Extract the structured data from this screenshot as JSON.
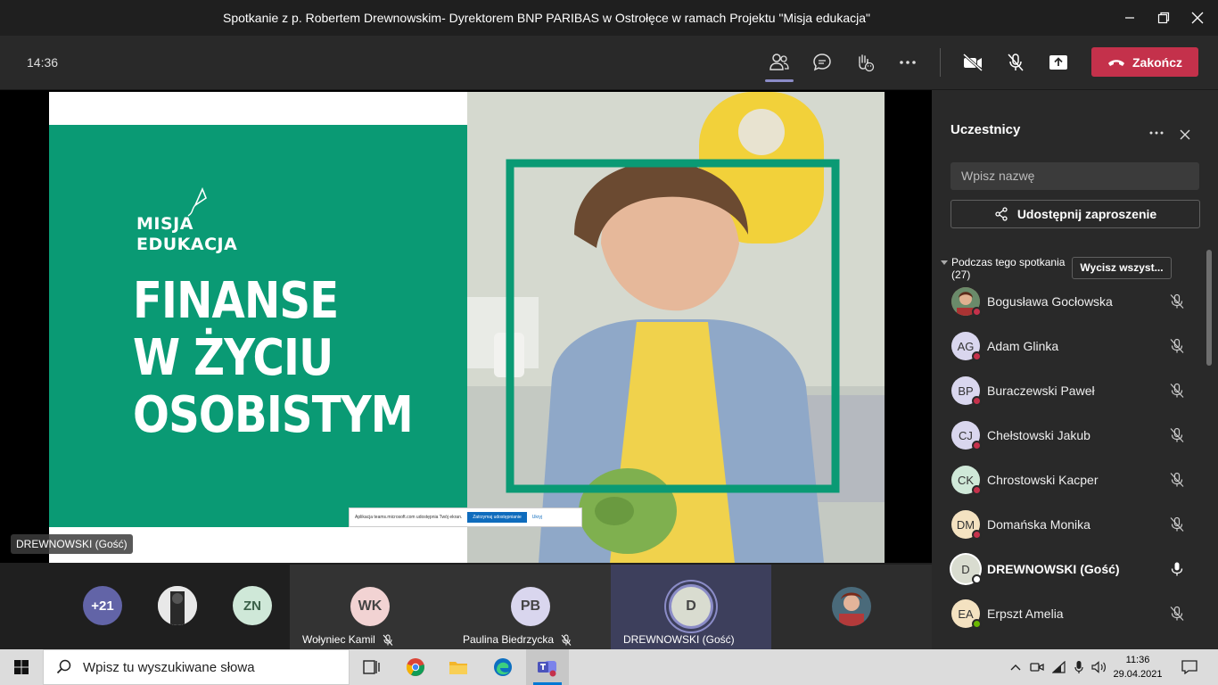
{
  "window": {
    "title": "Spotkanie z p. Robertem Drewnowskim- Dyrektorem BNP PARIBAS w Ostrołęce w ramach Projektu \"Misja edukacja\""
  },
  "toolbar": {
    "timer": "14:36",
    "end_label": "Zakończ"
  },
  "slide": {
    "logo_line1": "MISJA",
    "logo_line2": "EDUKACJA",
    "headline_line1": "FINANSE",
    "headline_line2": "W ŻYCIU",
    "headline_line3": "OSOBISTYM",
    "share_notice": "Aplikacja teams.microsoft.com udostępnia Twój ekran.",
    "share_stop": "Zatrzymaj udostępnianie",
    "share_hide": "Ukryj",
    "presenter_caption": "DREWNOWSKI (Gość)"
  },
  "panel": {
    "title": "Uczestnicy",
    "search_placeholder": "Wpisz nazwę",
    "share_invite": "Udostępnij zaproszenie",
    "section_label": "Podczas tego spotkania (27)",
    "mute_all": "Wycisz wszyst...",
    "participants": [
      {
        "initials": "",
        "name": "Bogusława Gocłowska",
        "photo": true,
        "avatar_color": "#b35a4a",
        "status": "busy",
        "muted": true,
        "bold": false
      },
      {
        "initials": "AG",
        "name": "Adam Glinka",
        "avatar_color": "#d9d6ee",
        "status": "busy",
        "muted": true,
        "bold": false
      },
      {
        "initials": "BP",
        "name": "Buraczewski Paweł",
        "avatar_color": "#d9d6ee",
        "status": "busy",
        "muted": true,
        "bold": false
      },
      {
        "initials": "CJ",
        "name": "Chełstowski Jakub",
        "avatar_color": "#d9d6ee",
        "status": "busy",
        "muted": true,
        "bold": false
      },
      {
        "initials": "CK",
        "name": "Chrostowski Kacper",
        "avatar_color": "#cfe8d8",
        "status": "busy",
        "muted": true,
        "bold": false
      },
      {
        "initials": "DM",
        "name": "Domańska Monika",
        "avatar_color": "#f4e2c1",
        "status": "busy",
        "muted": true,
        "bold": false
      },
      {
        "initials": "D",
        "name": "DREWNOWSKI (Gość)",
        "avatar_color": "#d9dcd0",
        "status": "none",
        "muted": false,
        "bold": true
      },
      {
        "initials": "EA",
        "name": "Erpszt Amelia",
        "avatar_color": "#f4e2c1",
        "status": "available",
        "muted": true,
        "bold": false
      }
    ]
  },
  "gallery": {
    "overflow_count": "+21",
    "mini_zn": "ZN",
    "tiles": [
      {
        "initials": "WK",
        "name": "Wołyniec Kamil",
        "avatar_color": "#f2d3d3",
        "muted": true
      },
      {
        "initials": "PB",
        "name": "Paulina Biedrzycka",
        "avatar_color": "#d9d6ee",
        "muted": true
      },
      {
        "initials": "D",
        "name": "DREWNOWSKI (Gość)",
        "avatar_color": "#d9dcd0",
        "muted": false,
        "speaking": true
      }
    ]
  },
  "taskbar": {
    "search_placeholder": "Wpisz tu wyszukiwane słowa",
    "time": "11:36",
    "date": "29.04.2021"
  },
  "colors": {
    "accent": "#8b8cc7",
    "end_call": "#c4314b",
    "slide_green": "#0a9a74",
    "busy": "#c4314b",
    "available": "#6bb700"
  }
}
